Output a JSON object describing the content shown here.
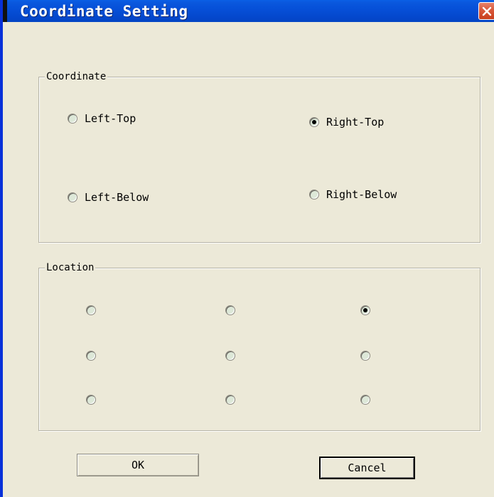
{
  "window": {
    "title": "Coordinate Setting",
    "close_icon": "close-icon"
  },
  "coordinate_group": {
    "legend": "Coordinate",
    "options": [
      {
        "label": "Left-Top",
        "checked": false
      },
      {
        "label": "Right-Top",
        "checked": true
      },
      {
        "label": "Left-Below",
        "checked": false
      },
      {
        "label": "Right-Below",
        "checked": false
      }
    ]
  },
  "location_group": {
    "legend": "Location",
    "selected": "row-1-col-3",
    "rows": [
      [
        false,
        false,
        true
      ],
      [
        false,
        false,
        false
      ],
      [
        false,
        false,
        false
      ]
    ]
  },
  "buttons": {
    "ok": "OK",
    "cancel": "Cancel"
  },
  "colors": {
    "title_bar": "#0a58de",
    "dialog_bg": "#ece9d8",
    "close_button": "#d9583a"
  }
}
